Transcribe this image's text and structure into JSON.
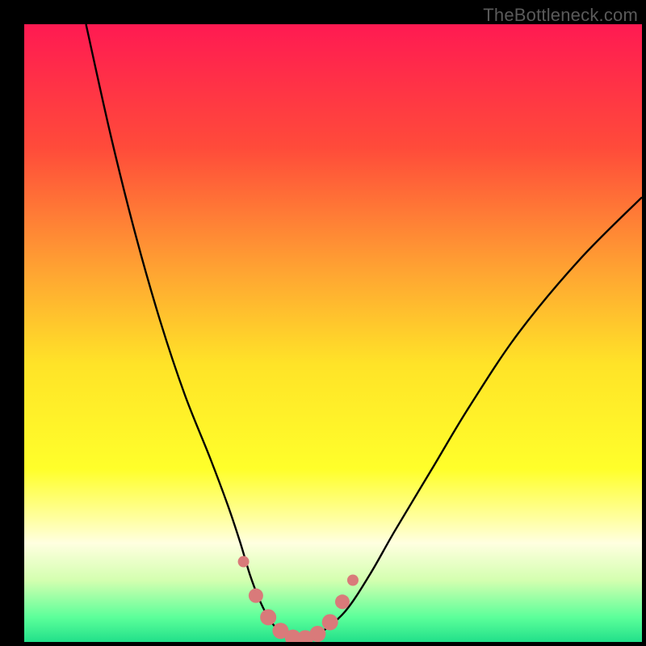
{
  "attribution": "TheBottleneck.com",
  "chart_data": {
    "type": "line",
    "title": "",
    "xlabel": "",
    "ylabel": "",
    "xlim": [
      0,
      100
    ],
    "ylim": [
      0,
      100
    ],
    "gradient_stops": [
      {
        "offset": 0,
        "color": "#ff1a52"
      },
      {
        "offset": 20,
        "color": "#ff4b3a"
      },
      {
        "offset": 40,
        "color": "#ffa432"
      },
      {
        "offset": 55,
        "color": "#ffe328"
      },
      {
        "offset": 72,
        "color": "#ffff2a"
      },
      {
        "offset": 80,
        "color": "#ffffa0"
      },
      {
        "offset": 84,
        "color": "#ffffe0"
      },
      {
        "offset": 90,
        "color": "#d4ffb0"
      },
      {
        "offset": 96,
        "color": "#5cff9a"
      },
      {
        "offset": 100,
        "color": "#22e08a"
      }
    ],
    "series": [
      {
        "name": "bottleneck-curve",
        "x": [
          10,
          14,
          18,
          22,
          26,
          30,
          33,
          35,
          36.5,
          38,
          39.5,
          41,
          42.5,
          44,
          46,
          48,
          52,
          56,
          60,
          66,
          72,
          80,
          90,
          100
        ],
        "y": [
          100,
          82,
          66,
          52,
          40,
          30,
          22,
          16,
          11,
          7,
          4,
          2,
          0.7,
          0.4,
          0.5,
          1.5,
          5,
          11,
          18,
          28,
          38,
          50,
          62,
          72
        ]
      }
    ],
    "markers": {
      "name": "highlight-points",
      "color": "#d97a7a",
      "points": [
        {
          "x": 35.5,
          "y": 13,
          "r": 7
        },
        {
          "x": 37.5,
          "y": 7.5,
          "r": 9
        },
        {
          "x": 39.5,
          "y": 4,
          "r": 10
        },
        {
          "x": 41.5,
          "y": 1.8,
          "r": 10
        },
        {
          "x": 43.5,
          "y": 0.7,
          "r": 10
        },
        {
          "x": 45.5,
          "y": 0.6,
          "r": 10
        },
        {
          "x": 47.5,
          "y": 1.3,
          "r": 10
        },
        {
          "x": 49.5,
          "y": 3.2,
          "r": 10
        },
        {
          "x": 51.5,
          "y": 6.5,
          "r": 9
        },
        {
          "x": 53.2,
          "y": 10,
          "r": 7
        }
      ]
    }
  }
}
